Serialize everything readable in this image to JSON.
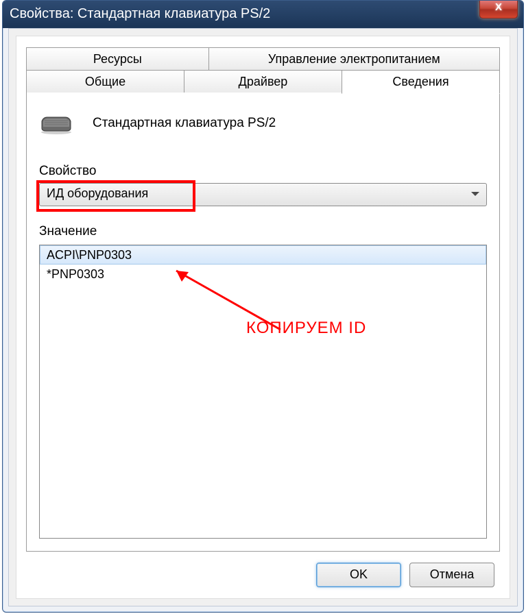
{
  "window": {
    "title": "Свойства: Стандартная клавиатура PS/2"
  },
  "tabs_row1": [
    {
      "label": "Ресурсы"
    },
    {
      "label": "Управление электропитанием"
    }
  ],
  "tabs_row2": [
    {
      "label": "Общие"
    },
    {
      "label": "Драйвер"
    },
    {
      "label": "Сведения"
    }
  ],
  "active_tab": "Сведения",
  "device": {
    "name": "Стандартная клавиатура PS/2"
  },
  "property_section": {
    "label": "Свойство"
  },
  "dropdown": {
    "selected": "ИД оборудования"
  },
  "value_section": {
    "label": "Значение"
  },
  "values": [
    "ACPI\\PNP0303",
    "*PNP0303"
  ],
  "annotation": {
    "text": "КОПИРУЕМ ID"
  },
  "buttons": {
    "ok": "OK",
    "cancel": "Отмена"
  },
  "close_glyph": "X"
}
